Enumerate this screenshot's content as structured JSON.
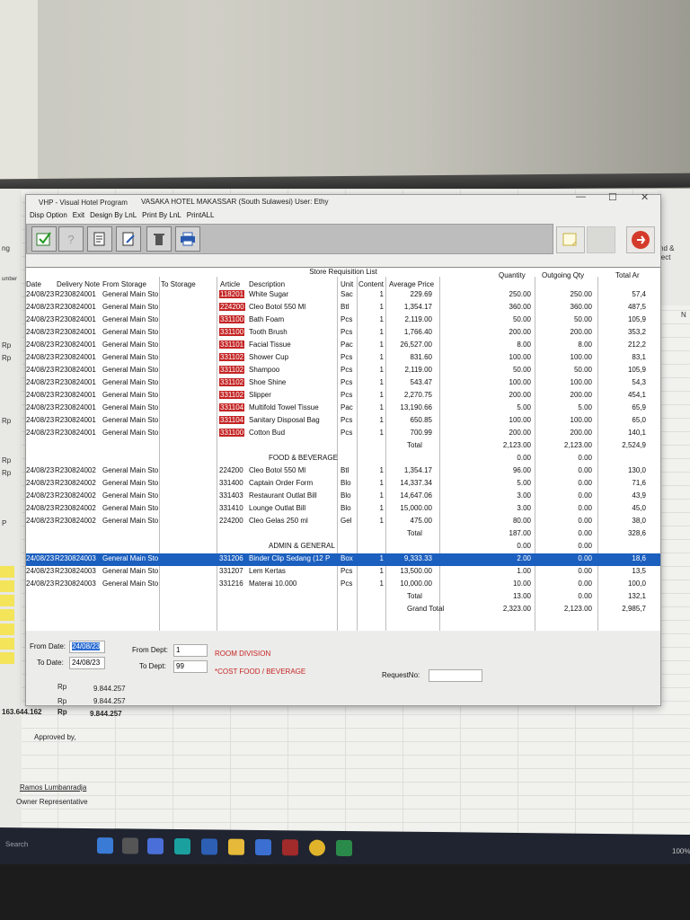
{
  "window": {
    "title": "VHP - Visual Hotel Program",
    "hotel_user": "VASAKA HOTEL MAKASSAR (South Sulawesi) User: Ethy",
    "menu": [
      "Disp Option",
      "Exit",
      "Design By LnL",
      "Print By LnL",
      "PrintALL"
    ],
    "controls": {
      "minimize": "—",
      "maximize": "☐",
      "close": "✕"
    }
  },
  "list": {
    "title": "Store Requisition List",
    "headers": {
      "date": "Date",
      "delivery_note": "Delivery Note",
      "from_storage": "From Storage",
      "to_storage": "To Storage",
      "article": "Article",
      "description": "Description",
      "unit": "Unit",
      "content": "Content",
      "avg_price": "Average Price",
      "quantity": "Quantity",
      "outgoing_qty": "Outgoing Qty",
      "total": "Total Ar"
    },
    "rows": [
      {
        "date": "24/08/23",
        "note": "R230824001",
        "from": "General Main Sto",
        "article": "118201",
        "desc": "White Sugar",
        "unit": "Sac",
        "content": "1",
        "price": "229.69",
        "qty": "250.00",
        "out": "250.00",
        "total": "57,4",
        "red": true
      },
      {
        "date": "24/08/23",
        "note": "R230824001",
        "from": "General Main Sto",
        "article": "224200",
        "desc": "Cleo Botol 550 Ml",
        "unit": "Btl",
        "content": "1",
        "price": "1,354.17",
        "qty": "360.00",
        "out": "360.00",
        "total": "487,5",
        "red": true
      },
      {
        "date": "24/08/23",
        "note": "R230824001",
        "from": "General Main Sto",
        "article": "331100",
        "desc": "Bath Foam",
        "unit": "Pcs",
        "content": "1",
        "price": "2,119.00",
        "qty": "50.00",
        "out": "50.00",
        "total": "105,9",
        "red": true
      },
      {
        "date": "24/08/23",
        "note": "R230824001",
        "from": "General Main Sto",
        "article": "331100",
        "desc": "Tooth Brush",
        "unit": "Pcs",
        "content": "1",
        "price": "1,766.40",
        "qty": "200.00",
        "out": "200.00",
        "total": "353,2",
        "red": true
      },
      {
        "date": "24/08/23",
        "note": "R230824001",
        "from": "General Main Sto",
        "article": "331101",
        "desc": "Facial Tissue",
        "unit": "Pac",
        "content": "1",
        "price": "26,527.00",
        "qty": "8.00",
        "out": "8.00",
        "total": "212,2",
        "red": true
      },
      {
        "date": "24/08/23",
        "note": "R230824001",
        "from": "General Main Sto",
        "article": "331102",
        "desc": "Shower Cup",
        "unit": "Pcs",
        "content": "1",
        "price": "831.60",
        "qty": "100.00",
        "out": "100.00",
        "total": "83,1",
        "red": true
      },
      {
        "date": "24/08/23",
        "note": "R230824001",
        "from": "General Main Sto",
        "article": "331102",
        "desc": "Shampoo",
        "unit": "Pcs",
        "content": "1",
        "price": "2,119.00",
        "qty": "50.00",
        "out": "50.00",
        "total": "105,9",
        "red": true
      },
      {
        "date": "24/08/23",
        "note": "R230824001",
        "from": "General Main Sto",
        "article": "331102",
        "desc": "Shoe Shine",
        "unit": "Pcs",
        "content": "1",
        "price": "543.47",
        "qty": "100.00",
        "out": "100.00",
        "total": "54,3",
        "red": true
      },
      {
        "date": "24/08/23",
        "note": "R230824001",
        "from": "General Main Sto",
        "article": "331102",
        "desc": "Slipper",
        "unit": "Pcs",
        "content": "1",
        "price": "2,270.75",
        "qty": "200.00",
        "out": "200.00",
        "total": "454,1",
        "red": true
      },
      {
        "date": "24/08/23",
        "note": "R230824001",
        "from": "General Main Sto",
        "article": "331104",
        "desc": "Multifold Towel Tissue",
        "unit": "Pac",
        "content": "1",
        "price": "13,190.66",
        "qty": "5.00",
        "out": "5.00",
        "total": "65,9",
        "red": true
      },
      {
        "date": "24/08/23",
        "note": "R230824001",
        "from": "General Main Sto",
        "article": "331104",
        "desc": "Sanitary Disposal Bag",
        "unit": "Pcs",
        "content": "1",
        "price": "650.85",
        "qty": "100.00",
        "out": "100.00",
        "total": "65,0",
        "red": true
      },
      {
        "date": "24/08/23",
        "note": "R230824001",
        "from": "General Main Sto",
        "article": "331100",
        "desc": "Cotton Bud",
        "unit": "Pcs",
        "content": "1",
        "price": "700.99",
        "qty": "200.00",
        "out": "200.00",
        "total": "140,1",
        "red": true
      },
      {
        "date": "",
        "note": "",
        "from": "",
        "article": "",
        "desc": "",
        "unit": "",
        "content": "",
        "price": "Total",
        "qty": "2,123.00",
        "out": "2,123.00",
        "total": "2,524,9"
      },
      {
        "date": "",
        "note": "",
        "from": "",
        "article": "",
        "desc": "FOOD & BEVERAGE",
        "unit": "",
        "content": "",
        "price": "",
        "qty": "0.00",
        "out": "0.00",
        "total": ""
      },
      {
        "date": "24/08/23",
        "note": "R230824002",
        "from": "General Main Sto",
        "article": "224200",
        "desc": "Cleo Botol 550 Ml",
        "unit": "Btl",
        "content": "1",
        "price": "1,354.17",
        "qty": "96.00",
        "out": "0.00",
        "total": "130,0"
      },
      {
        "date": "24/08/23",
        "note": "R230824002",
        "from": "General Main Sto",
        "article": "331400",
        "desc": "Captain Order Form",
        "unit": "Blo",
        "content": "1",
        "price": "14,337.34",
        "qty": "5.00",
        "out": "0.00",
        "total": "71,6"
      },
      {
        "date": "24/08/23",
        "note": "R230824002",
        "from": "General Main Sto",
        "article": "331403",
        "desc": "Restaurant Outlat Bill",
        "unit": "Blo",
        "content": "1",
        "price": "14,647.06",
        "qty": "3.00",
        "out": "0.00",
        "total": "43,9"
      },
      {
        "date": "24/08/23",
        "note": "R230824002",
        "from": "General Main Sto",
        "article": "331410",
        "desc": "Lounge Outlat Bill",
        "unit": "Blo",
        "content": "1",
        "price": "15,000.00",
        "qty": "3.00",
        "out": "0.00",
        "total": "45,0"
      },
      {
        "date": "24/08/23",
        "note": "R230824002",
        "from": "General Main Sto",
        "article": "224200",
        "desc": "Cleo Gelas 250 ml",
        "unit": "Gel",
        "content": "1",
        "price": "475.00",
        "qty": "80.00",
        "out": "0.00",
        "total": "38,0"
      },
      {
        "date": "",
        "note": "",
        "from": "",
        "article": "",
        "desc": "",
        "unit": "",
        "content": "",
        "price": "Total",
        "qty": "187.00",
        "out": "0.00",
        "total": "328,6"
      },
      {
        "date": "",
        "note": "",
        "from": "",
        "article": "",
        "desc": "ADMIN & GENERAL",
        "unit": "",
        "content": "",
        "price": "",
        "qty": "0.00",
        "out": "0.00",
        "total": ""
      },
      {
        "date": "24/08/23",
        "note": "R230824003",
        "from": "General Main Sto",
        "article": "331206",
        "desc": "Binder Clip Sedang (12 P",
        "unit": "Box",
        "content": "1",
        "price": "9,333.33",
        "qty": "2.00",
        "out": "0.00",
        "total": "18,6",
        "selected": true
      },
      {
        "date": "24/08/23",
        "note": "R230824003",
        "from": "General Main Sto",
        "article": "331207",
        "desc": "Lem Kertas",
        "unit": "Pcs",
        "content": "1",
        "price": "13,500.00",
        "qty": "1.00",
        "out": "0.00",
        "total": "13,5"
      },
      {
        "date": "24/08/23",
        "note": "R230824003",
        "from": "General Main Sto",
        "article": "331216",
        "desc": "Materai 10.000",
        "unit": "Pcs",
        "content": "1",
        "price": "10,000.00",
        "qty": "10.00",
        "out": "0.00",
        "total": "100,0"
      },
      {
        "date": "",
        "note": "",
        "from": "",
        "article": "",
        "desc": "",
        "unit": "",
        "content": "",
        "price": "Total",
        "qty": "13.00",
        "out": "0.00",
        "total": "132,1"
      },
      {
        "date": "",
        "note": "",
        "from": "",
        "article": "",
        "desc": "",
        "unit": "",
        "content": "",
        "price": "Grand Total",
        "qty": "2,323.00",
        "out": "2,123.00",
        "total": "2,985,7"
      }
    ]
  },
  "filter": {
    "from_date_label": "From Date:",
    "from_date_value": "24/08/23",
    "to_date_label": "To Date:",
    "to_date_value": "24/08/23",
    "from_dept_label": "From Dept:",
    "from_dept_value": "1",
    "to_dept_label": "To Dept:",
    "to_dept_value": "99",
    "dept_name_1": "ROOM DIVISION",
    "dept_name_2": "*COST FOOD / BEVERAGE",
    "request_label": "RequestNo:",
    "request_value": ""
  },
  "sheet": {
    "left_fragments": [
      "ng",
      "umber",
      "Rp",
      "Rp",
      "Rp",
      "Rp",
      "Rp",
      "P"
    ],
    "rp_rows": [
      {
        "label": "Rp",
        "value": "9.844.257"
      },
      {
        "label": "Rp",
        "value": "9.844.257"
      },
      {
        "prefix": "163.644.162",
        "label": "Rp",
        "value": "9.844.257"
      }
    ],
    "approved_by": "Approved by,",
    "signer_name": "Ramos Lumbanradja",
    "signer_title": "Owner Representative",
    "right_fragments": [
      "nd &",
      "lect",
      "N"
    ]
  },
  "taskbar": {
    "search": "Search",
    "zoom": "100%"
  }
}
